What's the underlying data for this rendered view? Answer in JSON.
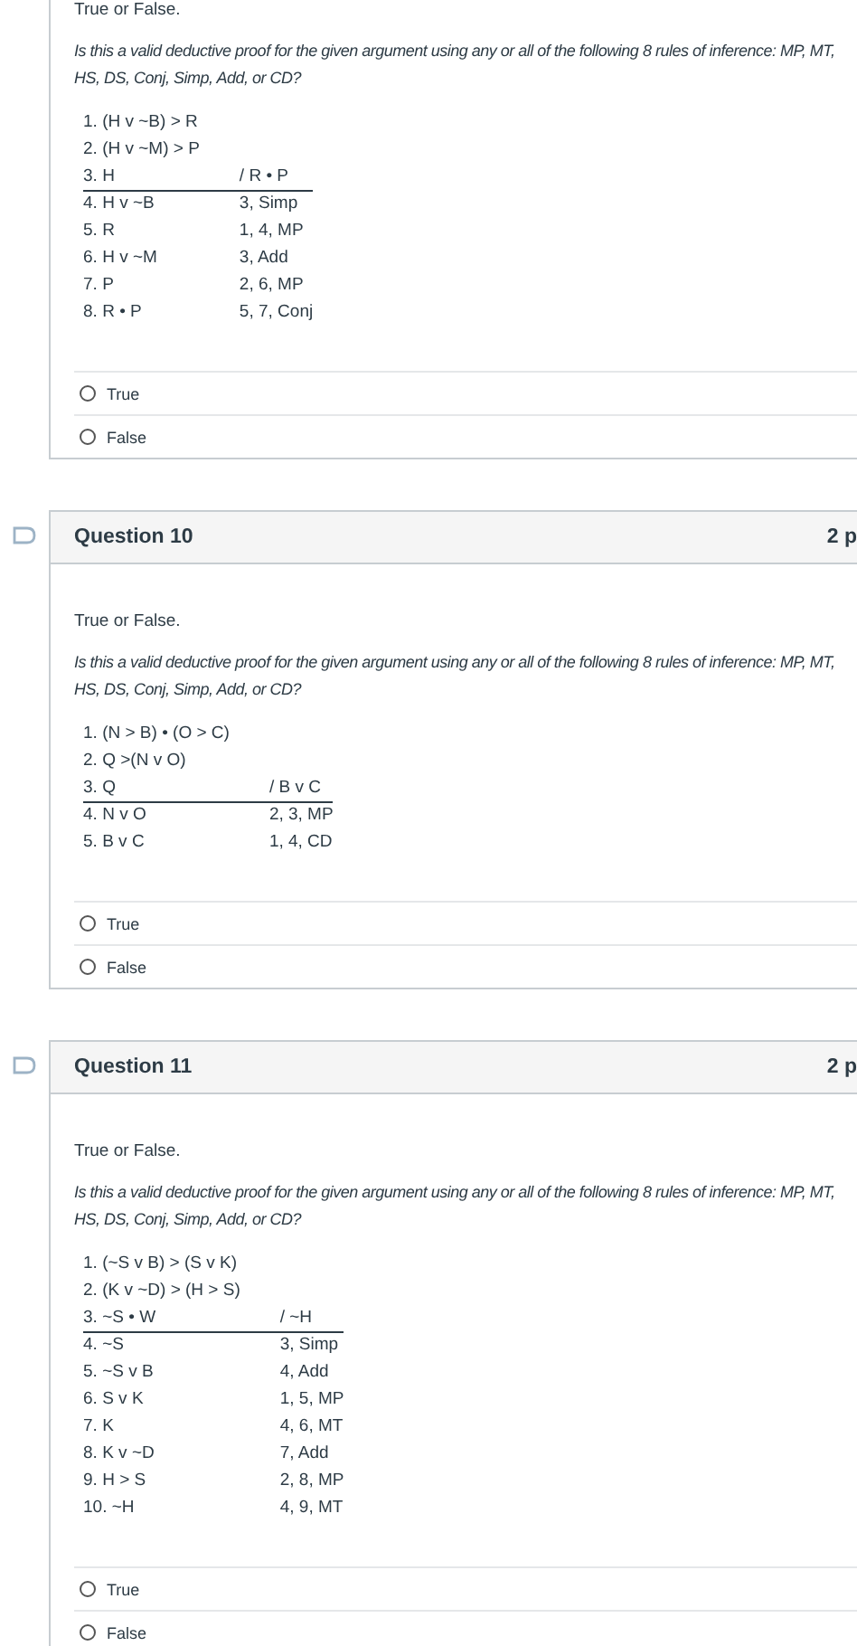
{
  "questions": [
    {
      "prompt": "True or False.",
      "question": "Is this a valid deductive proof for the given argument using any or all of the following 8 rules of inference: MP, MT, HS, DS, Conj, Simp, Add, or CD?",
      "proof": [
        {
          "kind": "premise",
          "number": "1.",
          "formula": "(H v ~B) > R"
        },
        {
          "kind": "premise",
          "number": "2.",
          "formula": "(H v ~M) > P"
        },
        {
          "kind": "conclusion",
          "number": "3.",
          "formula": "H",
          "justification": "/ R • P"
        },
        {
          "kind": "step",
          "number": "4.",
          "formula": "H v ~B",
          "justification": "3, Simp"
        },
        {
          "kind": "step",
          "number": "5.",
          "formula": "R",
          "justification": "1, 4, MP"
        },
        {
          "kind": "step",
          "number": "6.",
          "formula": "H v ~M",
          "justification": "3, Add"
        },
        {
          "kind": "step",
          "number": "7.",
          "formula": "P",
          "justification": "2, 6, MP"
        },
        {
          "kind": "step",
          "number": "8.",
          "formula": "R • P",
          "justification": "5, 7, Conj"
        }
      ],
      "options": [
        {
          "label": "True",
          "selected": false
        },
        {
          "label": "False",
          "selected": false
        }
      ]
    },
    {
      "title": "Question 10",
      "points": "2 p",
      "prompt": "True or False.",
      "question": "Is this a valid deductive proof for the given argument using any or all of the following 8 rules of inference: MP, MT, HS, DS, Conj, Simp, Add, or CD?",
      "proof": [
        {
          "kind": "premise",
          "number": "1.",
          "formula": "(N > B) • (O > C)"
        },
        {
          "kind": "premise",
          "number": "2.",
          "formula": "Q >(N v O)"
        },
        {
          "kind": "conclusion",
          "number": "3.",
          "formula": "Q",
          "justification": "/ B v C"
        },
        {
          "kind": "step",
          "number": "4.",
          "formula": "N v O",
          "justification": "2, 3, MP"
        },
        {
          "kind": "step",
          "number": "5.",
          "formula": "B v C",
          "justification": "1, 4, CD"
        }
      ],
      "options": [
        {
          "label": "True",
          "selected": false
        },
        {
          "label": "False",
          "selected": false
        }
      ]
    },
    {
      "title": "Question 11",
      "points": "2 p",
      "prompt": "True or False.",
      "question": "Is this a valid deductive proof for the given argument using any or all of the following 8 rules of inference: MP, MT, HS, DS, Conj, Simp, Add, or CD?",
      "proof": [
        {
          "kind": "premise",
          "number": "1.",
          "formula": "(~S v B) > (S v K)"
        },
        {
          "kind": "premise",
          "number": "2.",
          "formula": "(K v ~D) > (H > S)"
        },
        {
          "kind": "conclusion",
          "number": "3.",
          "formula": "~S • W",
          "justification": "/ ~H"
        },
        {
          "kind": "step",
          "number": "4.",
          "formula": "~S",
          "justification": "3, Simp"
        },
        {
          "kind": "step",
          "number": "5.",
          "formula": "~S v B",
          "justification": "4, Add"
        },
        {
          "kind": "step",
          "number": "6.",
          "formula": "S v K",
          "justification": "1, 5, MP"
        },
        {
          "kind": "step",
          "number": "7.",
          "formula": "K",
          "justification": "4, 6, MT"
        },
        {
          "kind": "step",
          "number": "8.",
          "formula": "K v ~D",
          "justification": "7, Add"
        },
        {
          "kind": "step",
          "number": "9.",
          "formula": "H > S",
          "justification": "2, 8, MP"
        },
        {
          "kind": "step",
          "number": "10.",
          "formula": "~H",
          "justification": "4, 9, MT"
        }
      ],
      "options": [
        {
          "label": "True",
          "selected": false
        },
        {
          "label": "False",
          "selected": false
        }
      ]
    }
  ]
}
